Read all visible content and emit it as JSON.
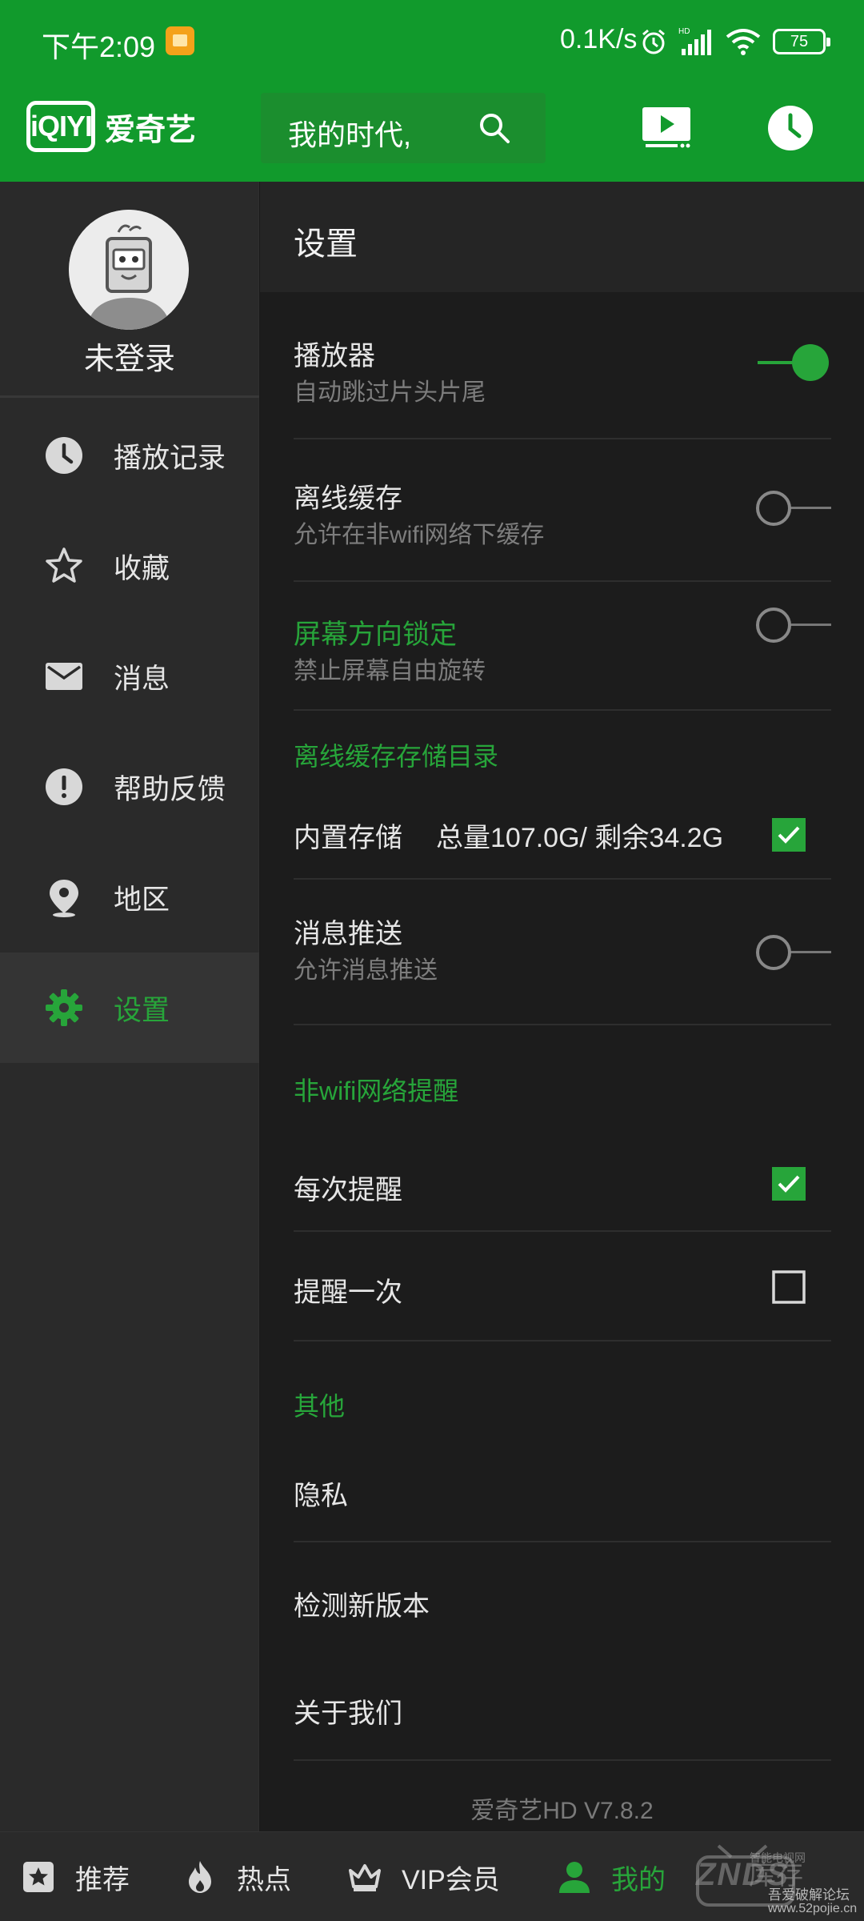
{
  "status_bar": {
    "time": "下午2:09",
    "net_speed": "0.1K/s",
    "battery": "75"
  },
  "header": {
    "logo_mark": "iQIYI",
    "logo_text": "爱奇艺",
    "search_text": "我的时代,"
  },
  "drawer": {
    "login_text": "未登录",
    "items": [
      {
        "label": "播放记录",
        "icon": "clock-icon"
      },
      {
        "label": "收藏",
        "icon": "star-icon"
      },
      {
        "label": "消息",
        "icon": "mail-icon"
      },
      {
        "label": "帮助反馈",
        "icon": "alert-icon"
      },
      {
        "label": "地区",
        "icon": "location-icon"
      },
      {
        "label": "设置",
        "icon": "gear-icon",
        "active": true
      }
    ]
  },
  "settings": {
    "title": "设置",
    "player": {
      "title": "播放器",
      "sub": "自动跳过片头片尾",
      "on": true
    },
    "offline_cache": {
      "title": "离线缓存",
      "sub": "允许在非wifi网络下缓存",
      "on": false
    },
    "screen_lock": {
      "title": "屏幕方向锁定",
      "sub": "禁止屏幕自由旋转",
      "on": false
    },
    "storage_section": "离线缓存存储目录",
    "storage": {
      "name": "内置存储",
      "info": "总量107.0G/ 剩余34.2G",
      "checked": true
    },
    "push": {
      "title": "消息推送",
      "sub": "允许消息推送",
      "on": false
    },
    "wifi_section": "非wifi网络提醒",
    "remind_every": {
      "title": "每次提醒",
      "checked": true
    },
    "remind_once": {
      "title": "提醒一次",
      "checked": false
    },
    "other_section": "其他",
    "privacy": "隐私",
    "check_update": "检测新版本",
    "about": "关于我们",
    "version": "爱奇艺HD V7.8.2"
  },
  "bottom_nav": [
    {
      "label": "推荐",
      "icon": "star-badge-icon"
    },
    {
      "label": "热点",
      "icon": "flame-icon"
    },
    {
      "label": "VIP会员",
      "icon": "crown-icon"
    },
    {
      "label": "我的",
      "icon": "person-icon",
      "active": true
    }
  ],
  "watermark": {
    "brand": "ZNDS",
    "brand_cn": "智能电视网",
    "suffix": "库存",
    "forum": "吾爱破解论坛",
    "url": "www.52pojie.cn"
  },
  "colors": {
    "brand_green": "#119a2c",
    "accent_green": "#27a53a",
    "background": "#1c1c1c",
    "drawer_bg": "#2a2a2a"
  }
}
